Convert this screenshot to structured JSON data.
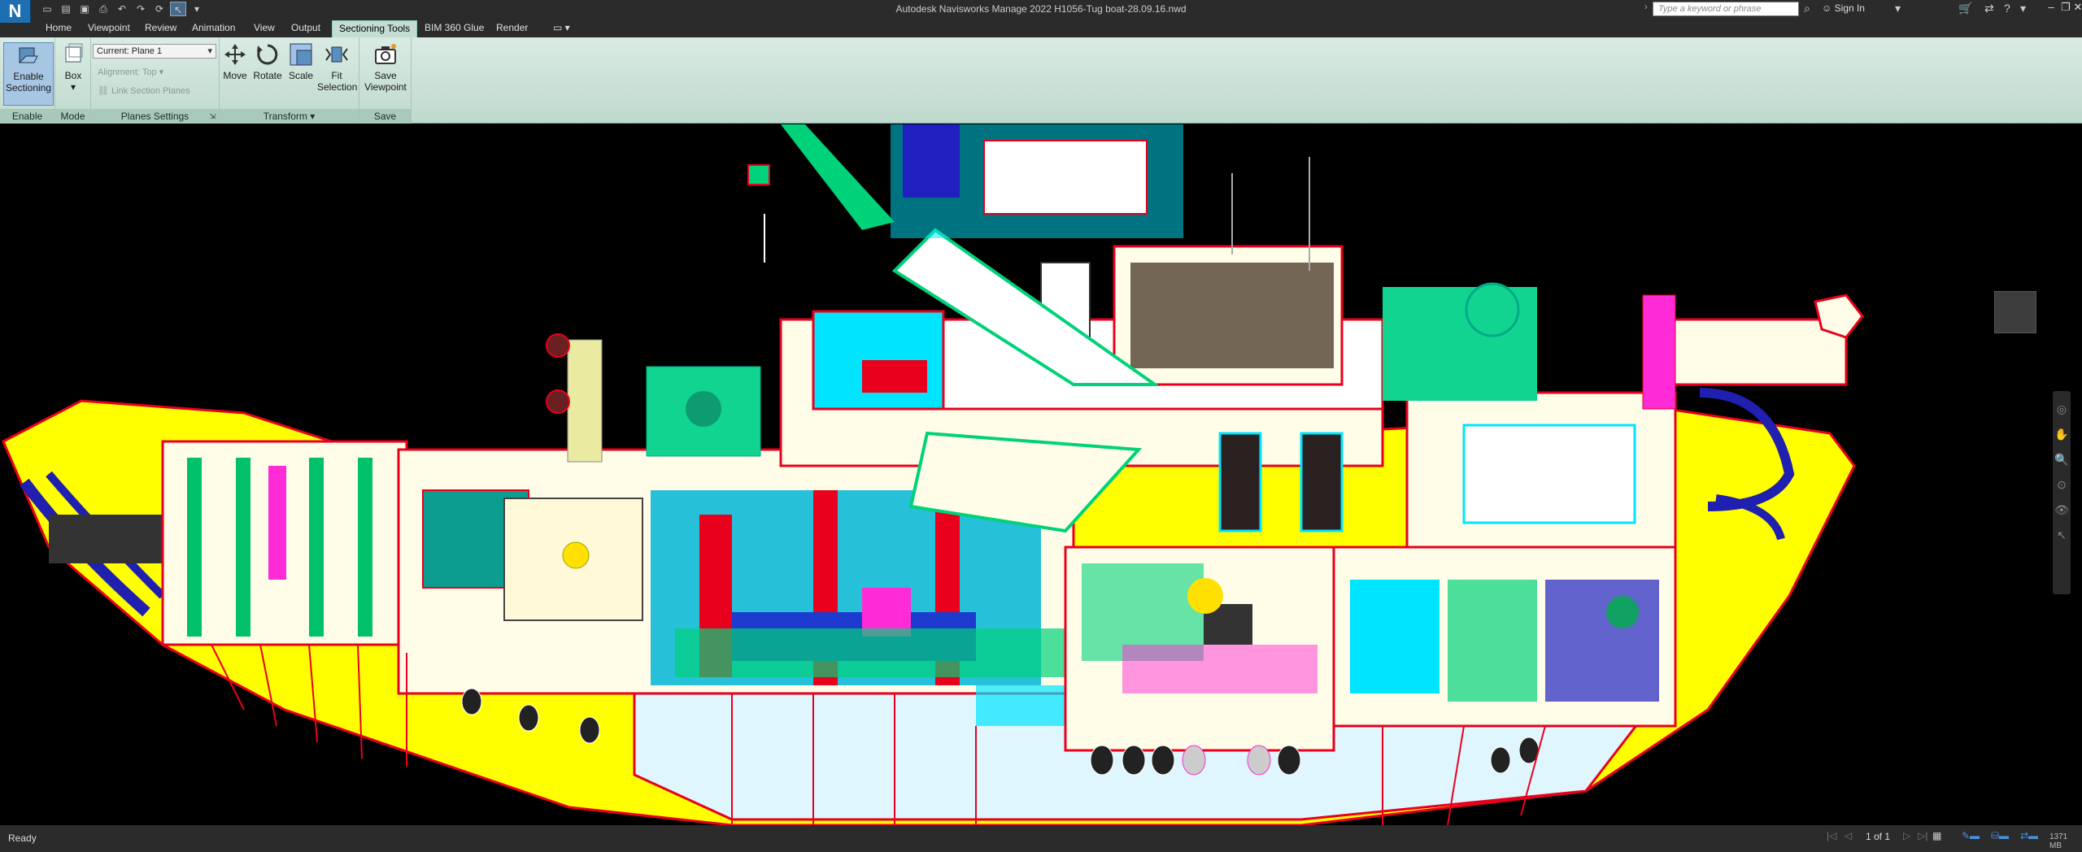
{
  "app": {
    "logo": "N",
    "title": "Autodesk Navisworks Manage 2022    H1056-Tug boat-28.09.16.nwd"
  },
  "search": {
    "placeholder": "Type a keyword or phrase"
  },
  "user": {
    "signin_label": "Sign In"
  },
  "tabs": [
    {
      "label": "Home"
    },
    {
      "label": "Viewpoint"
    },
    {
      "label": "Review"
    },
    {
      "label": "Animation"
    },
    {
      "label": "View"
    },
    {
      "label": "Output"
    },
    {
      "label": "Sectioning Tools",
      "active": true
    },
    {
      "label": "BIM 360 Glue"
    },
    {
      "label": "Render"
    }
  ],
  "ribbon": {
    "enable": {
      "button_label_1": "Enable",
      "button_label_2": "Sectioning",
      "group_label": "Enable"
    },
    "mode": {
      "button_label": "Box",
      "group_label": "Mode"
    },
    "planes": {
      "current_plane": "Current: Plane 1",
      "alignment": "Alignment: Top",
      "link": "Link Section Planes",
      "group_label": "Planes Settings"
    },
    "transform": {
      "move": "Move",
      "rotate": "Rotate",
      "scale": "Scale",
      "fit_1": "Fit",
      "fit_2": "Selection",
      "group_label": "Transform"
    },
    "save": {
      "button_label_1": "Save",
      "button_label_2": "Viewpoint",
      "group_label": "Save"
    }
  },
  "status": {
    "text": "Ready",
    "page": "1 of 1",
    "memory": "1371 MB"
  },
  "colors": {
    "ribbon_bg": "#cfe5db",
    "hull_yellow": "#ffff00",
    "hull_white": "#fffde8",
    "section_red": "#e8001c",
    "cyan": "#00e5ff",
    "green": "#00d27a"
  }
}
